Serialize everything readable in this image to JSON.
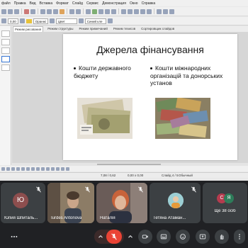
{
  "office": {
    "menu": [
      "файл",
      "Правка",
      "Вид",
      "Вставка",
      "Формат",
      "Слайд",
      "Сервис",
      "Демонстрация",
      "Окно",
      "Справка"
    ],
    "toolbar": {
      "font_size": "0,00",
      "fill_color_combo": "Оранжі",
      "line_style_combo": "Цвет",
      "area_color_combo": "Синий кле"
    },
    "view_tabs": [
      "Режим рисования",
      "Режим структуры",
      "Режим примечаний",
      "Режим тезисов",
      "Сортировщик слайдов"
    ],
    "active_view_tab": 0,
    "slide": {
      "title": "Джерела фінансування",
      "bullets_left": [
        "Кошти державного бюджету"
      ],
      "bullets_right": [
        "Кошти міжнародних організацій та донорських установ"
      ]
    },
    "status": {
      "position": "7,08 / 0,62",
      "size": "0,00 x 0,00",
      "slide_info": "Слайд 4 / 5",
      "layout": "Обычный"
    }
  },
  "meet": {
    "participants": [
      {
        "name": "Юлия Шпиталь...",
        "initial": "Ю",
        "avatar_color": "#8d4e4e",
        "muted": true,
        "video": false
      },
      {
        "name": "Iurdes Antonova",
        "initial": "",
        "muted": true,
        "video": true
      },
      {
        "name": "Наталія",
        "initial": "",
        "muted": true,
        "video": true
      },
      {
        "name": "Тетяна Атаман...",
        "initial": "",
        "muted": true,
        "video": false,
        "avatar_color": "#a8d4d8"
      },
      {
        "name": "Ще 38 осіб",
        "initial": "",
        "video": false
      }
    ],
    "more_avatars": [
      "С",
      "Я"
    ],
    "more_avatar_colors": [
      "#b53b4e",
      "#2e7d5a"
    ],
    "colors": {
      "tile_bg": "#3c4043",
      "danger": "#ea4335",
      "control_bg": "#3c4043"
    },
    "controls": [
      "more-options-icon",
      "mic-off-icon",
      "chevron-up-icon",
      "camera-icon",
      "captions-icon",
      "emoji-icon",
      "present-icon",
      "raise-hand-icon",
      "more-vert-icon"
    ]
  }
}
